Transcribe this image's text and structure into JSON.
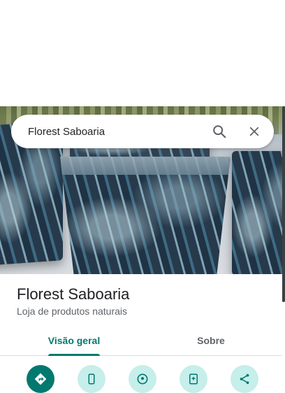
{
  "search": {
    "query": "Florest Saboaria"
  },
  "place": {
    "name": "Florest Saboaria",
    "category": "Loja de produtos naturais"
  },
  "tabs": [
    {
      "label": "Visão geral",
      "selected": true
    },
    {
      "label": "Sobre",
      "selected": false
    }
  ],
  "actions": [
    {
      "icon": "directions-icon",
      "primary": true
    },
    {
      "icon": "phone-icon",
      "primary": false
    },
    {
      "icon": "nearby-icon",
      "primary": false
    },
    {
      "icon": "save-icon",
      "primary": false
    },
    {
      "icon": "share-icon",
      "primary": false
    }
  ],
  "colors": {
    "accent": "#01796f",
    "action_bg": "#c6eeeb",
    "text_primary": "#202124",
    "text_secondary": "#5f6368"
  }
}
